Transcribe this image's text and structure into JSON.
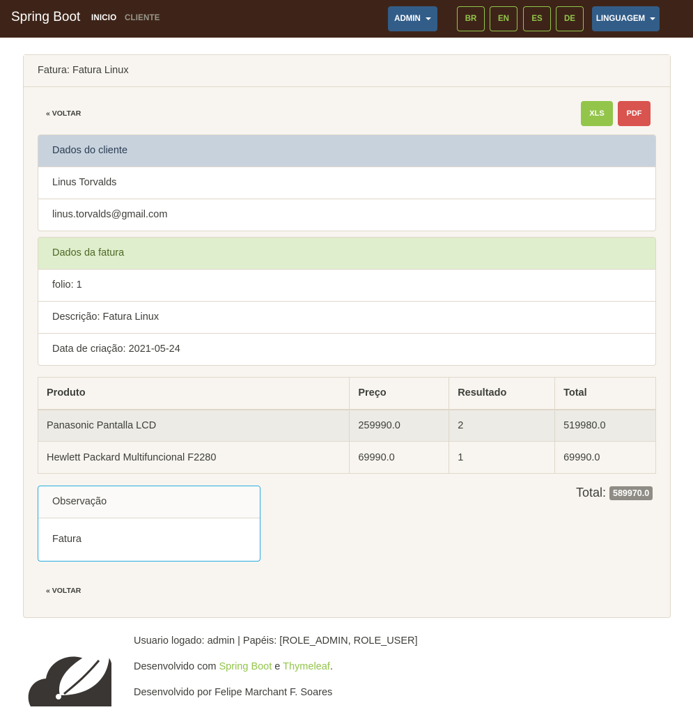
{
  "navbar": {
    "brand": "Spring Boot",
    "links": [
      "INICIO",
      "CLIENTE"
    ],
    "admin_label": "ADMIN",
    "languages": [
      "BR",
      "EN",
      "ES",
      "DE"
    ],
    "language_menu_label": "LINGUAGEM"
  },
  "invoice": {
    "header": "Fatura: Fatura Linux",
    "back_label": "« VOLTAR",
    "export_xls": "XLS",
    "export_pdf": "PDF",
    "client_section": {
      "title": "Dados do cliente",
      "name": "Linus Torvalds",
      "email": "linus.torvalds@gmail.com"
    },
    "invoice_section": {
      "title": "Dados da fatura",
      "folio": "folio: 1",
      "description": "Descrição: Fatura Linux",
      "created": "Data de criação: 2021-05-24"
    },
    "table": {
      "headers": [
        "Produto",
        "Preço",
        "Resultado",
        "Total"
      ],
      "rows": [
        [
          "Panasonic Pantalla LCD",
          "259990.0",
          "2",
          "519980.0"
        ],
        [
          "Hewlett Packard Multifuncional F2280",
          "69990.0",
          "1",
          "69990.0"
        ]
      ]
    },
    "total_label": "Total:",
    "total_value": "589970.0",
    "observation": {
      "title": "Observação",
      "text": "Fatura"
    }
  },
  "footer": {
    "logged_user": "Usuario logado: admin | Papéis: [ROLE_ADMIN, ROLE_USER]",
    "developed_with_prefix": "Desenvolvido com ",
    "link1": "Spring Boot",
    "and": " e ",
    "link2": "Thymeleaf",
    "period": ".",
    "author": "Desenvolvido por Felipe Marchant F. Soares"
  },
  "colors": {
    "navbar_bg": "#3e2418",
    "primary": "#325d88",
    "success": "#93c54b",
    "danger": "#d9534f",
    "info": "#29abe0"
  }
}
